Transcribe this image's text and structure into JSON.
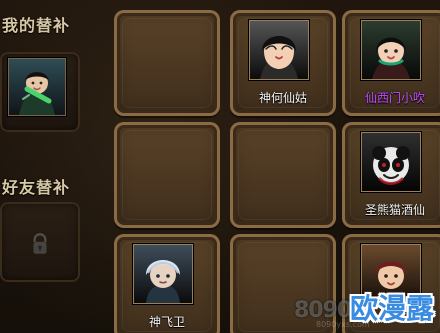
{
  "left_panel": {
    "my_substitute_title": "我的替补",
    "friend_substitute_title": "好友替补"
  },
  "grid": {
    "slots": [
      {
        "hero_name": "",
        "hero_icon": "empty-slot"
      },
      {
        "hero_name": "神何仙姑",
        "hero_icon": "hero-he-xiangu-portrait"
      },
      {
        "hero_name": "仙西门小吹",
        "hero_icon": "hero-ximen-xiaochui-portrait"
      },
      {
        "hero_name": "",
        "hero_icon": "empty-slot"
      },
      {
        "hero_name": "",
        "hero_icon": "empty-slot"
      },
      {
        "hero_name": "圣熊猫酒仙",
        "hero_icon": "hero-panda-jiuxian-portrait"
      },
      {
        "hero_name": "神飞卫",
        "hero_icon": "hero-fei-wei-portrait"
      },
      {
        "hero_name": "",
        "hero_icon": "empty-slot"
      },
      {
        "hero_name": "",
        "hero_icon": "hero-unknown-portrait"
      }
    ]
  },
  "watermark": {
    "logo_text": "8090",
    "main_text": "欧漫露",
    "url_text": "8090yxs.com"
  },
  "colors": {
    "purple_name": "#c24cff",
    "gold_border": "#8b6b45",
    "wm_blue": "#3a8be2"
  }
}
